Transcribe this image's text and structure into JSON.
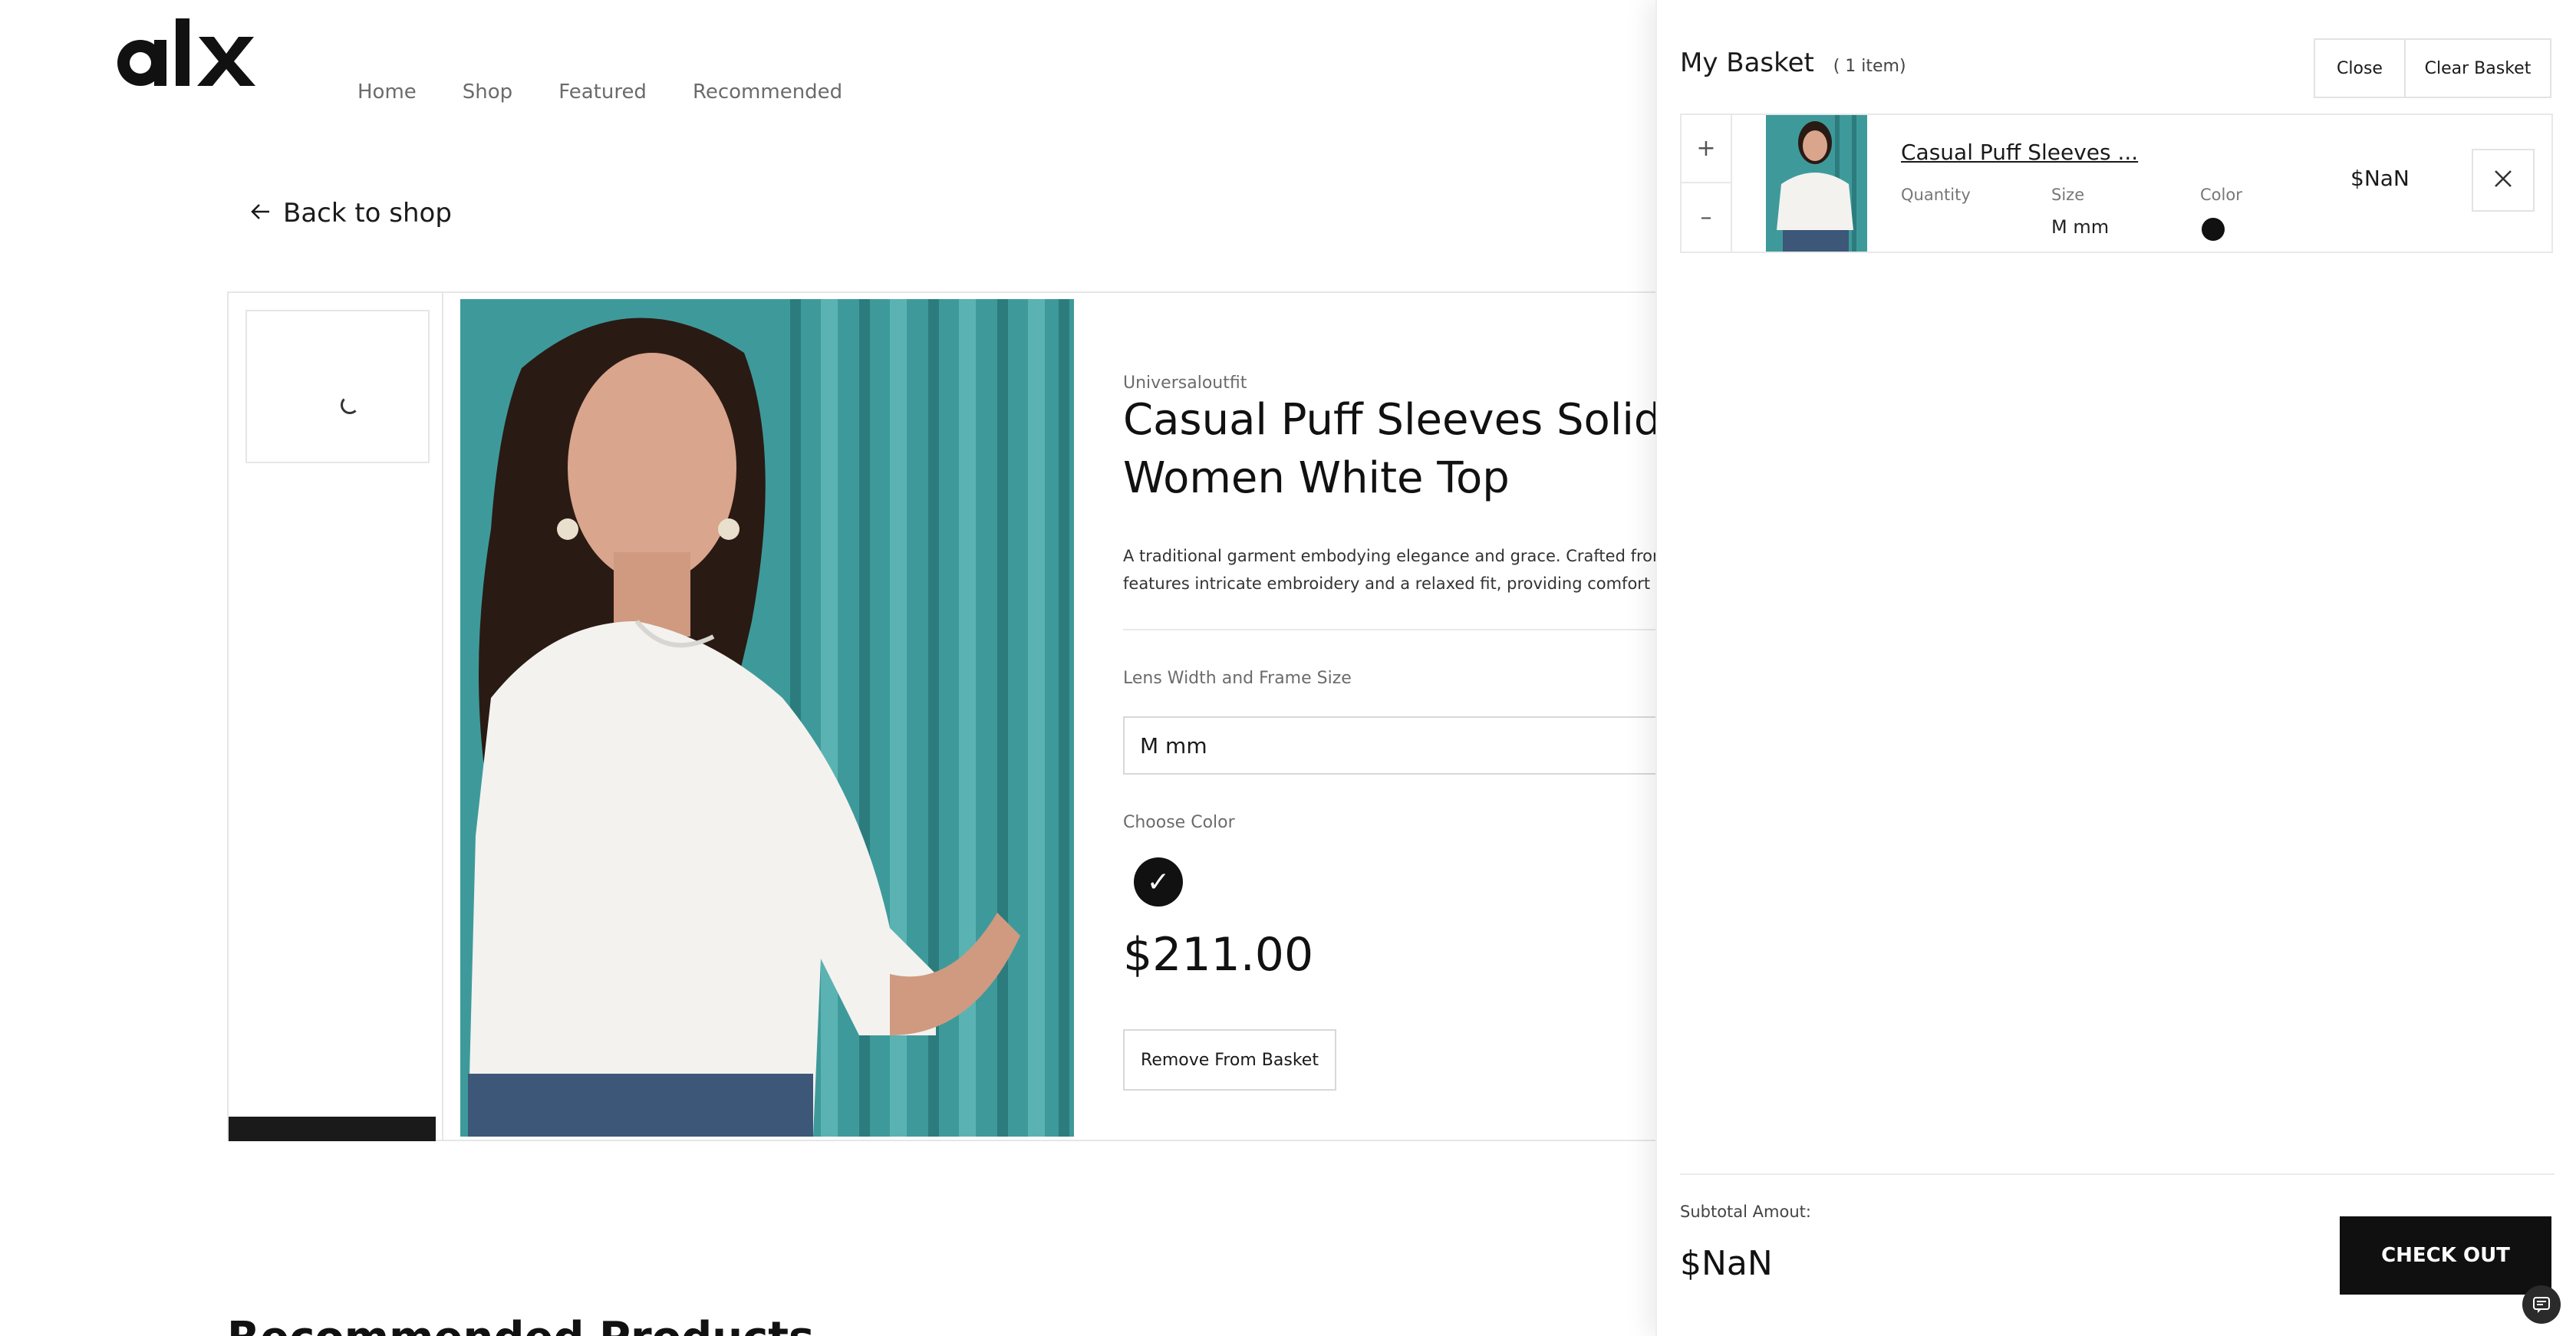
{
  "header": {
    "logo_text": "alx",
    "nav": [
      "Home",
      "Shop",
      "Featured",
      "Recommended"
    ]
  },
  "back_link": {
    "label": "Back to shop",
    "icon": "arrow-left-icon"
  },
  "product": {
    "brand": "Universaloutfit",
    "title": "Casual Puff Sleeves Solid Women White Top",
    "description_line1": "A traditional garment embodying elegance and grace. Crafted from f",
    "description_line2": "features intricate embroidery and a relaxed fit, providing comfort and",
    "size_label": "Lens Width and Frame Size",
    "size_value": "M mm",
    "color_label": "Choose Color",
    "selected_color": "#111111",
    "price": "$211.00",
    "remove_button": "Remove From Basket"
  },
  "recommended_peek": "Recommended Products",
  "basket": {
    "title": "My Basket",
    "count": "( 1 item)",
    "close_label": "Close",
    "clear_label": "Clear Basket",
    "item": {
      "name": "Casual Puff Sleeves ...",
      "quantity_label": "Quantity",
      "size_label": "Size",
      "size_value": "M mm",
      "color_label": "Color",
      "color": "#111111",
      "price": "$NaN",
      "plus": "+",
      "minus": "–"
    },
    "subtotal_label": "Subtotal Amout:",
    "subtotal_value": "$NaN",
    "checkout_label": "CHECK OUT"
  }
}
